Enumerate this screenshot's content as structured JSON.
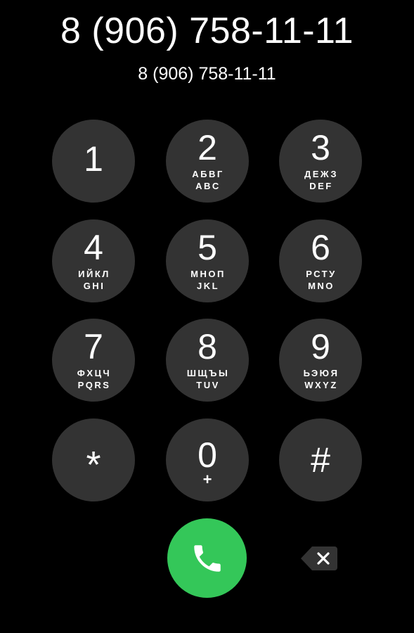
{
  "display": {
    "dialed_number": "8 (906) 758-11-11",
    "caller_info": "8 (906) 758-11-11"
  },
  "keypad": {
    "keys": [
      {
        "digit": "1",
        "cyrillic": "",
        "latin": ""
      },
      {
        "digit": "2",
        "cyrillic": "АБВГ",
        "latin": "ABC"
      },
      {
        "digit": "3",
        "cyrillic": "ДЕЖЗ",
        "latin": "DEF"
      },
      {
        "digit": "4",
        "cyrillic": "ИЙКЛ",
        "latin": "GHI"
      },
      {
        "digit": "5",
        "cyrillic": "МНОП",
        "latin": "JKL"
      },
      {
        "digit": "6",
        "cyrillic": "РСТУ",
        "latin": "MNO"
      },
      {
        "digit": "7",
        "cyrillic": "ФХЦЧ",
        "latin": "PQRS"
      },
      {
        "digit": "8",
        "cyrillic": "ШЩЪЫ",
        "latin": "TUV"
      },
      {
        "digit": "9",
        "cyrillic": "ЬЭЮЯ",
        "latin": "WXYZ"
      },
      {
        "digit": "*"
      },
      {
        "digit": "0",
        "sub": "+"
      },
      {
        "digit": "#"
      }
    ]
  },
  "actions": {
    "call_icon": "phone-icon",
    "delete_icon": "backspace-icon"
  },
  "colors": {
    "background": "#000000",
    "key_fill": "#333333",
    "call_green": "#34c759",
    "text": "#ffffff"
  }
}
